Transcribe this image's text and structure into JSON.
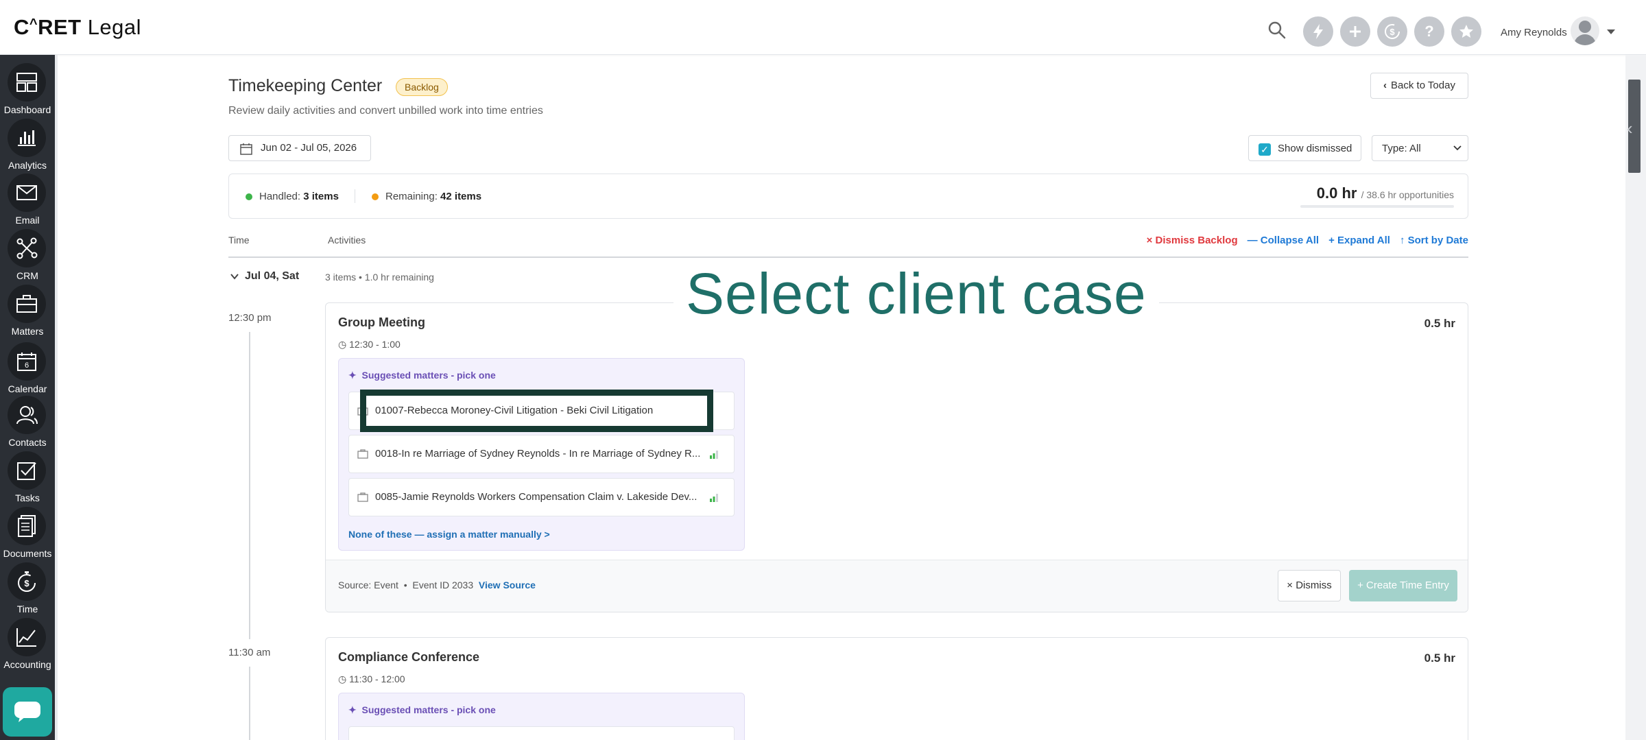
{
  "app": {
    "logo": {
      "text_a": "C",
      "text_b": "RET",
      "text_c": " Legal",
      "caret": "^"
    },
    "user_name": "Amy Reynolds"
  },
  "sidebar": {
    "items": [
      {
        "label": "Dashboard",
        "icon": "dashboard-icon"
      },
      {
        "label": "Analytics",
        "icon": "bar-chart-icon"
      },
      {
        "label": "Email",
        "icon": "envelope-icon"
      },
      {
        "label": "CRM",
        "icon": "network-icon"
      },
      {
        "label": "Matters",
        "icon": "briefcase-icon"
      },
      {
        "label": "Calendar",
        "icon": "calendar-icon",
        "day": "6"
      },
      {
        "label": "Contacts",
        "icon": "contacts-icon"
      },
      {
        "label": "Tasks",
        "icon": "checkbox-icon"
      },
      {
        "label": "Documents",
        "icon": "document-icon"
      },
      {
        "label": "Time",
        "icon": "stopwatch-icon"
      },
      {
        "label": "Accounting",
        "icon": "line-chart-icon"
      }
    ]
  },
  "header_icons": {
    "search": "search-icon",
    "quick": "lightning-icon",
    "add": "plus-icon",
    "billing": "dollar-clock-icon",
    "help": "question-icon",
    "favorites": "star-icon"
  },
  "page": {
    "title": "Timekeeping Center",
    "badge": "Backlog",
    "subtitle": "Review daily activities and convert unbilled work into time entries",
    "back_button": "Back to Today",
    "date_range": "Jun 02 - Jul 05, 2026",
    "show_dismissed_label": "Show dismissed",
    "type_filter": "Type: All"
  },
  "summary": {
    "handled_label": "Handled:",
    "handled_value": "3 items",
    "remaining_label": "Remaining:",
    "remaining_value": "42 items",
    "hours": "0.0 hr",
    "opportunities": "/ 38.6 hr opportunities",
    "handled_color": "#3db44a",
    "remaining_color": "#f39c12"
  },
  "table": {
    "col_time": "Time",
    "col_activities": "Activities",
    "dismiss_backlog": "× Dismiss Backlog",
    "collapse_all": "— Collapse All",
    "expand_all": "+ Expand All",
    "sort_by_date": "↑ Sort by Date"
  },
  "day": {
    "label": "Jul 04, Sat",
    "meta": "3 items • 1.0 hr remaining"
  },
  "entries": [
    {
      "time_label": "12:30 pm",
      "title": "Group Meeting",
      "range": "12:30 - 1:00",
      "hours": "0.5 hr",
      "suggest_title": "Suggested matters - pick one",
      "matters": [
        "01007-Rebecca Moroney-Civil Litigation - Beki Civil Litigation",
        "0018-In re Marriage of Sydney Reynolds - In re Marriage of Sydney R...",
        "0085-Jamie Reynolds Workers Compensation Claim v. Lakeside Dev..."
      ],
      "manual_link": "None of these — assign a matter manually >",
      "source": "Source: Event",
      "event_id": "Event ID 2033",
      "view_source": "View Source",
      "dismiss": "× Dismiss",
      "create": "+ Create Time Entry"
    },
    {
      "time_label": "11:30 am",
      "title": "Compliance Conference",
      "range": "11:30 - 12:00",
      "hours": "0.5 hr",
      "suggest_title": "Suggested matters - pick one"
    }
  ],
  "overlay": {
    "instruction": "Select client case"
  }
}
